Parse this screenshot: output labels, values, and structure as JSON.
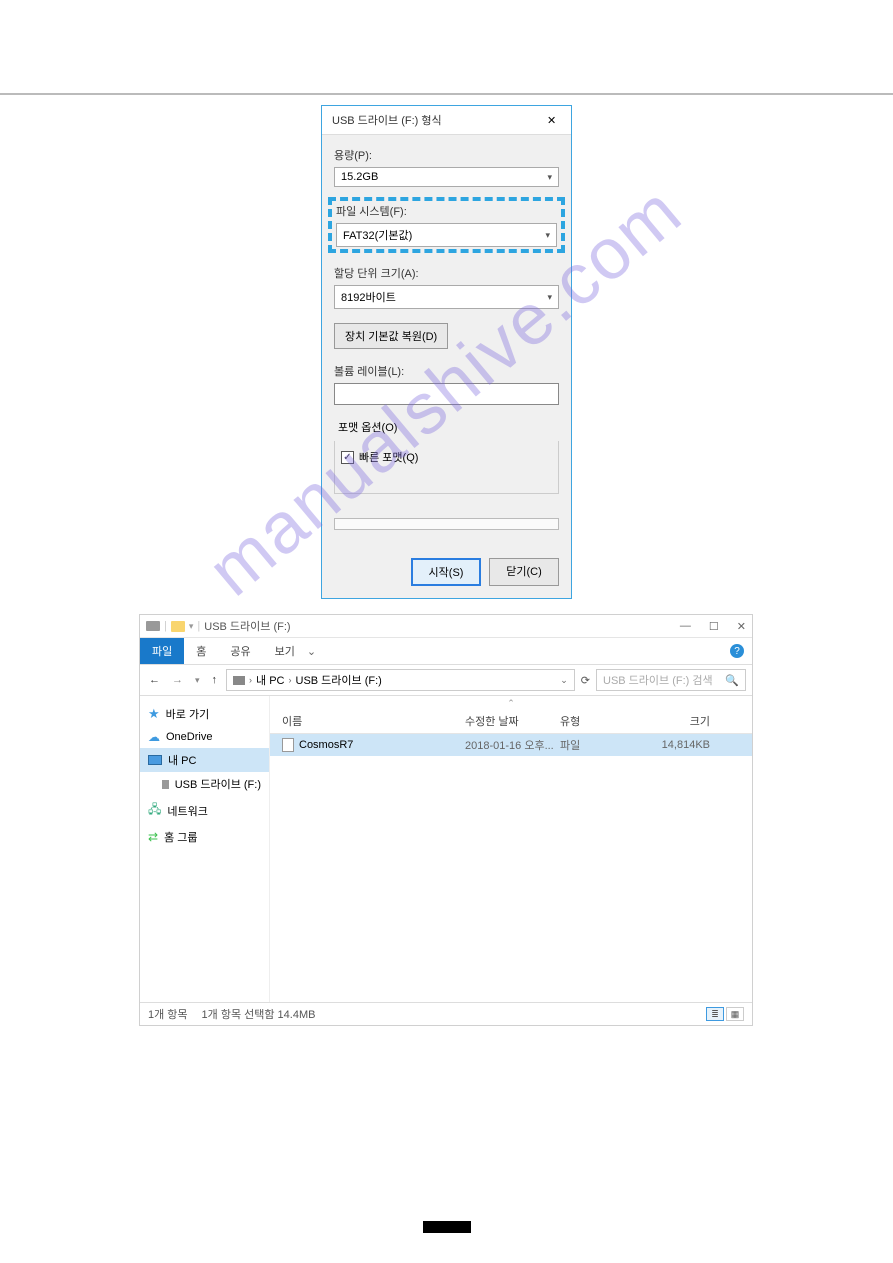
{
  "watermark": "manualshive.com",
  "format_dialog": {
    "title": "USB 드라이브 (F:) 형식",
    "capacity_label": "용량(P):",
    "capacity_value": "15.2GB",
    "filesystem_label": "파일 시스템(F):",
    "filesystem_value": "FAT32(기본값)",
    "alloc_label": "할당 단위 크기(A):",
    "alloc_value": "8192바이트",
    "restore_btn": "장치 기본값 복원(D)",
    "volume_label": "볼륨 레이블(L):",
    "volume_value": "",
    "options_legend": "포맷 옵션(O)",
    "quick_format": "빠른 포맷(Q)",
    "start_btn": "시작(S)",
    "close_btn": "닫기(C)"
  },
  "explorer": {
    "title": "USB 드라이브 (F:)",
    "tabs": {
      "file": "파일",
      "home": "홈",
      "share": "공유",
      "view": "보기"
    },
    "breadcrumb": {
      "pc": "내 PC",
      "drive": "USB 드라이브 (F:)"
    },
    "search_placeholder": "USB 드라이브 (F:) 검색",
    "sidebar": {
      "quick": "바로 가기",
      "onedrive": "OneDrive",
      "pc": "내 PC",
      "usb": "USB 드라이브 (F:)",
      "network": "네트워크",
      "homegroup": "홈 그룹"
    },
    "columns": {
      "name": "이름",
      "date": "수정한 날짜",
      "type": "유형",
      "size": "크기"
    },
    "file": {
      "name": "CosmosR7",
      "date": "2018-01-16 오후...",
      "type": "파일",
      "size": "14,814KB"
    },
    "status": {
      "count": "1개 항목",
      "selected": "1개 항목 선택함 14.4MB"
    }
  }
}
